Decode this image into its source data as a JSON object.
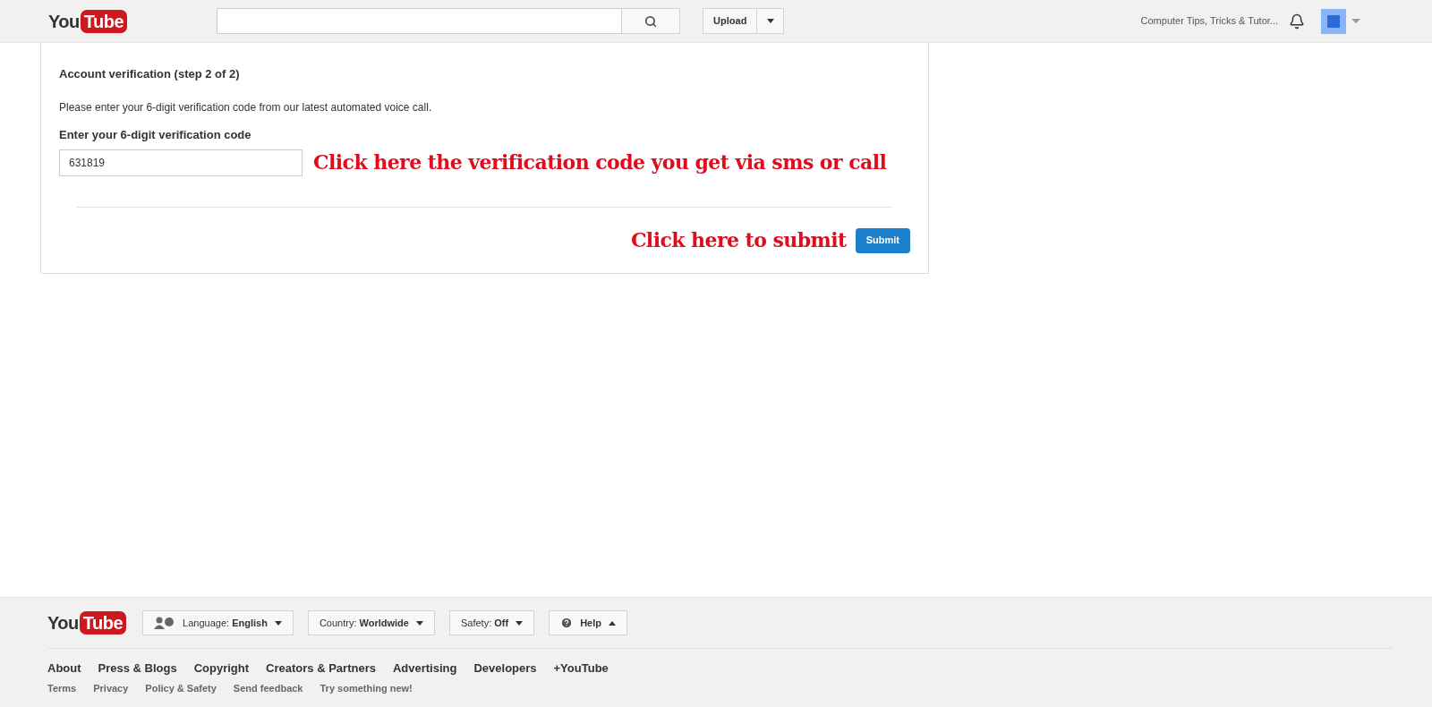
{
  "header": {
    "logo": {
      "you": "You",
      "tube": "Tube"
    },
    "upload": "Upload",
    "channel": "Computer Tips, Tricks & Tutor..."
  },
  "verification": {
    "title": "Account verification (step 2 of 2)",
    "instruction": "Please enter your 6-digit verification code from our latest automated voice call.",
    "field_label": "Enter your 6-digit verification code",
    "code": "631819",
    "code_note": "Click here the verification code you get via sms or call",
    "submit_note": "Click here to submit",
    "submit": "Submit"
  },
  "footer": {
    "logo": {
      "you": "You",
      "tube": "Tube"
    },
    "menus": [
      {
        "kind": "language",
        "label": "Language: **English**",
        "expanded": false
      },
      {
        "kind": "plain",
        "label": "Country: **Worldwide**",
        "expanded": false
      },
      {
        "kind": "plain",
        "label": "Safety: **Off**",
        "expanded": false
      },
      {
        "kind": "help",
        "label": "Help",
        "expanded": true
      }
    ],
    "primary_links": [
      "About",
      "Press & Blogs",
      "Copyright",
      "Creators & Partners",
      "Advertising",
      "Developers",
      "+YouTube"
    ],
    "secondary_links": [
      "Terms",
      "Privacy",
      "Policy & Safety",
      "Send feedback",
      "Try something new!"
    ]
  }
}
